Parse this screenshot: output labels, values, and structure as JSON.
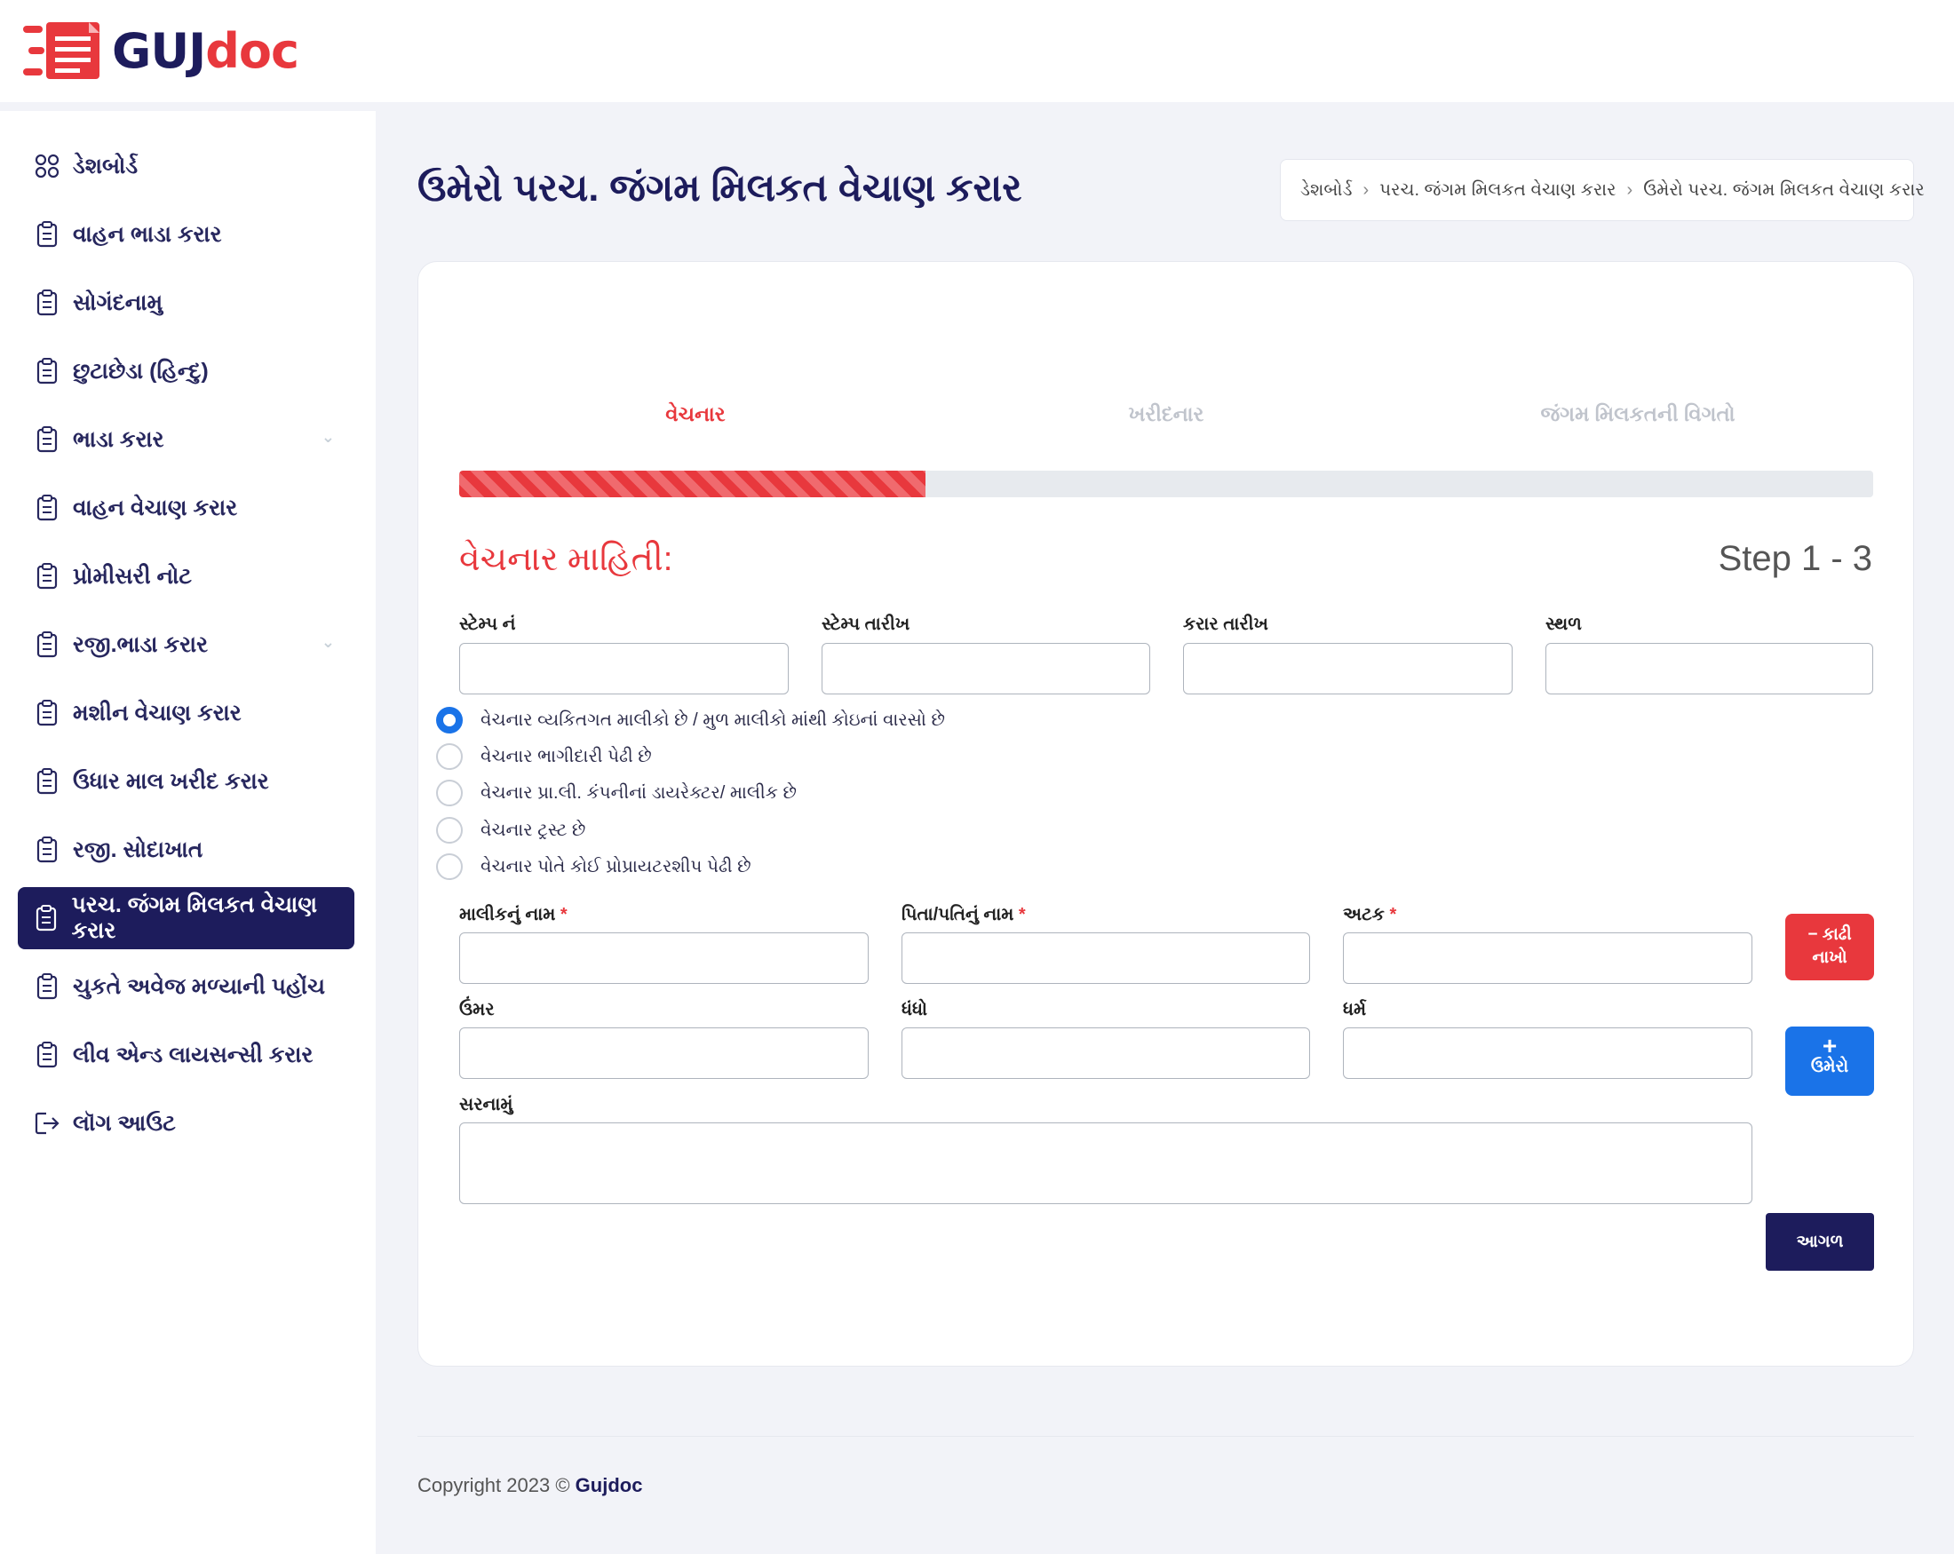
{
  "brand": {
    "logo_part1": "GUJ",
    "logo_part2": "doc",
    "accent": "#e8383d",
    "navy": "#1d1c5c",
    "blue": "#1a73e8"
  },
  "sidebar": {
    "items": [
      {
        "label": "ડેશબોર્ડ",
        "icon": "grid-icon"
      },
      {
        "label": "વાહન ભાડા કરાર",
        "icon": "clipboard-icon"
      },
      {
        "label": "સોગંદનામુ",
        "icon": "clipboard-icon"
      },
      {
        "label": "છુટાછેડા (હિન્દુ)",
        "icon": "clipboard-icon"
      },
      {
        "label": "ભાડા કરાર",
        "icon": "clipboard-icon"
      },
      {
        "label": "વાહન વેચાણ કરાર",
        "icon": "clipboard-icon"
      },
      {
        "label": "પ્રોમીસરી નોટ",
        "icon": "clipboard-icon"
      },
      {
        "label": "રજી.ભાડા કરાર",
        "icon": "clipboard-icon"
      },
      {
        "label": "મશીન વેચાણ કરાર",
        "icon": "clipboard-icon"
      },
      {
        "label": "ઉધાર માલ ખરીદ કરાર",
        "icon": "clipboard-icon"
      },
      {
        "label": "રજી. સોદાખાત",
        "icon": "clipboard-icon"
      },
      {
        "label": "પરચ. જંગમ મિલકત વેચાણ કરાર",
        "icon": "clipboard-icon",
        "active": true
      },
      {
        "label": "ચુકતે અવેજ મળ્યાની પહોંચ",
        "icon": "clipboard-icon"
      },
      {
        "label": "લીવ એન્ડ લાયસન્સી કરાર",
        "icon": "clipboard-icon"
      },
      {
        "label": "લૉગ આઉટ",
        "icon": "logout-icon"
      }
    ]
  },
  "header": {
    "title": "ઉમેરો પરચ. જંગમ મિલકત વેચાણ કરાર",
    "breadcrumb": [
      "ડેશબોર્ડ",
      "પરચ. જંગમ મિલકત વેચાણ કરાર",
      "ઉમેરો પરચ. જંગમ મિલકત વેચાણ કરાર"
    ]
  },
  "steps": {
    "labels": [
      "વેચનાર",
      "ખરીદનાર",
      "જંગમ મિલકતની વિગતો"
    ],
    "active_index": 0,
    "progress_percent": 33
  },
  "form": {
    "section_title": "વેચનાર માહિતી:",
    "step_text": "Step 1 - 3",
    "top_fields": [
      "સ્ટેમ્પ નં",
      "સ્ટેમ્પ તારીખ",
      "કરાર તારીખ",
      "સ્થળ"
    ],
    "radios": [
      {
        "label": "વેચનાર વ્યકિતગત માલીકો છે / મુળ માલીકો માંથી કોઇનાં વારસો છે",
        "checked": true
      },
      {
        "label": "વેચનાર ભાગીદારી પેઢી છે",
        "checked": false
      },
      {
        "label": "વેચનાર પ્રા.લી. કંપનીનાં ડાયરેક્ટર/ માલીક છે",
        "checked": false
      },
      {
        "label": "વેચનાર ટ્રસ્ટ છે",
        "checked": false
      },
      {
        "label": "વેચનાર પોતે કોઈ પ્રોપ્રાયટરશીપ પેઢી છે",
        "checked": false
      }
    ],
    "row1": [
      "માલીકનું નામ",
      "પિતા/પતિનું નામ",
      "અટક"
    ],
    "row2": [
      "ઉંમર",
      "ધંધો",
      "ધર્મ"
    ],
    "address_label": "સરનામું",
    "remove_btn": {
      "line1": "− કાઢી",
      "line2": "નાખો"
    },
    "add_btn": {
      "line1": "+",
      "line2": "ઉમેરો"
    },
    "next_btn": "આગળ"
  },
  "footer": {
    "text": "Copyright 2023 © ",
    "brand": "Gujdoc"
  }
}
